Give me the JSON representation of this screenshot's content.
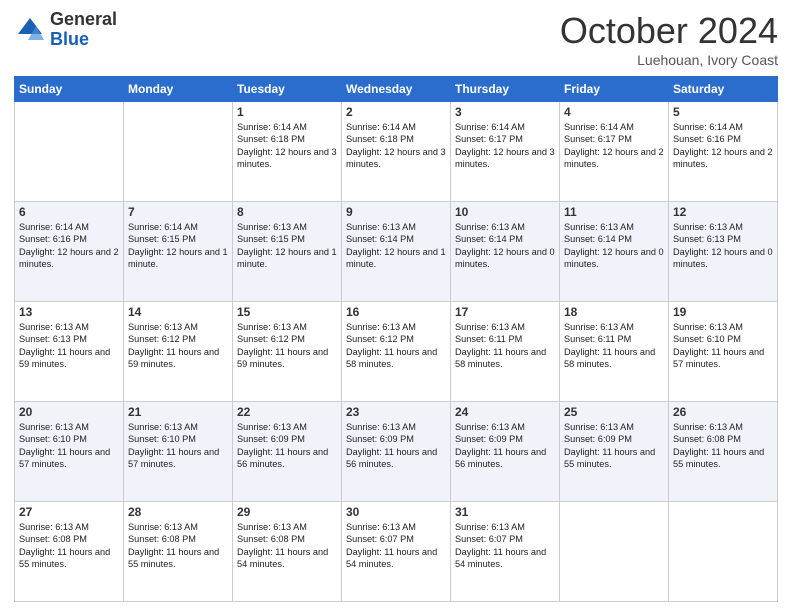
{
  "header": {
    "logo_general": "General",
    "logo_blue": "Blue",
    "month": "October 2024",
    "location": "Luehouan, Ivory Coast"
  },
  "weekdays": [
    "Sunday",
    "Monday",
    "Tuesday",
    "Wednesday",
    "Thursday",
    "Friday",
    "Saturday"
  ],
  "weeks": [
    [
      {
        "day": "",
        "text": ""
      },
      {
        "day": "",
        "text": ""
      },
      {
        "day": "1",
        "text": "Sunrise: 6:14 AM\nSunset: 6:18 PM\nDaylight: 12 hours and 3 minutes."
      },
      {
        "day": "2",
        "text": "Sunrise: 6:14 AM\nSunset: 6:18 PM\nDaylight: 12 hours and 3 minutes."
      },
      {
        "day": "3",
        "text": "Sunrise: 6:14 AM\nSunset: 6:17 PM\nDaylight: 12 hours and 3 minutes."
      },
      {
        "day": "4",
        "text": "Sunrise: 6:14 AM\nSunset: 6:17 PM\nDaylight: 12 hours and 2 minutes."
      },
      {
        "day": "5",
        "text": "Sunrise: 6:14 AM\nSunset: 6:16 PM\nDaylight: 12 hours and 2 minutes."
      }
    ],
    [
      {
        "day": "6",
        "text": "Sunrise: 6:14 AM\nSunset: 6:16 PM\nDaylight: 12 hours and 2 minutes."
      },
      {
        "day": "7",
        "text": "Sunrise: 6:14 AM\nSunset: 6:15 PM\nDaylight: 12 hours and 1 minute."
      },
      {
        "day": "8",
        "text": "Sunrise: 6:13 AM\nSunset: 6:15 PM\nDaylight: 12 hours and 1 minute."
      },
      {
        "day": "9",
        "text": "Sunrise: 6:13 AM\nSunset: 6:14 PM\nDaylight: 12 hours and 1 minute."
      },
      {
        "day": "10",
        "text": "Sunrise: 6:13 AM\nSunset: 6:14 PM\nDaylight: 12 hours and 0 minutes."
      },
      {
        "day": "11",
        "text": "Sunrise: 6:13 AM\nSunset: 6:14 PM\nDaylight: 12 hours and 0 minutes."
      },
      {
        "day": "12",
        "text": "Sunrise: 6:13 AM\nSunset: 6:13 PM\nDaylight: 12 hours and 0 minutes."
      }
    ],
    [
      {
        "day": "13",
        "text": "Sunrise: 6:13 AM\nSunset: 6:13 PM\nDaylight: 11 hours and 59 minutes."
      },
      {
        "day": "14",
        "text": "Sunrise: 6:13 AM\nSunset: 6:12 PM\nDaylight: 11 hours and 59 minutes."
      },
      {
        "day": "15",
        "text": "Sunrise: 6:13 AM\nSunset: 6:12 PM\nDaylight: 11 hours and 59 minutes."
      },
      {
        "day": "16",
        "text": "Sunrise: 6:13 AM\nSunset: 6:12 PM\nDaylight: 11 hours and 58 minutes."
      },
      {
        "day": "17",
        "text": "Sunrise: 6:13 AM\nSunset: 6:11 PM\nDaylight: 11 hours and 58 minutes."
      },
      {
        "day": "18",
        "text": "Sunrise: 6:13 AM\nSunset: 6:11 PM\nDaylight: 11 hours and 58 minutes."
      },
      {
        "day": "19",
        "text": "Sunrise: 6:13 AM\nSunset: 6:10 PM\nDaylight: 11 hours and 57 minutes."
      }
    ],
    [
      {
        "day": "20",
        "text": "Sunrise: 6:13 AM\nSunset: 6:10 PM\nDaylight: 11 hours and 57 minutes."
      },
      {
        "day": "21",
        "text": "Sunrise: 6:13 AM\nSunset: 6:10 PM\nDaylight: 11 hours and 57 minutes."
      },
      {
        "day": "22",
        "text": "Sunrise: 6:13 AM\nSunset: 6:09 PM\nDaylight: 11 hours and 56 minutes."
      },
      {
        "day": "23",
        "text": "Sunrise: 6:13 AM\nSunset: 6:09 PM\nDaylight: 11 hours and 56 minutes."
      },
      {
        "day": "24",
        "text": "Sunrise: 6:13 AM\nSunset: 6:09 PM\nDaylight: 11 hours and 56 minutes."
      },
      {
        "day": "25",
        "text": "Sunrise: 6:13 AM\nSunset: 6:09 PM\nDaylight: 11 hours and 55 minutes."
      },
      {
        "day": "26",
        "text": "Sunrise: 6:13 AM\nSunset: 6:08 PM\nDaylight: 11 hours and 55 minutes."
      }
    ],
    [
      {
        "day": "27",
        "text": "Sunrise: 6:13 AM\nSunset: 6:08 PM\nDaylight: 11 hours and 55 minutes."
      },
      {
        "day": "28",
        "text": "Sunrise: 6:13 AM\nSunset: 6:08 PM\nDaylight: 11 hours and 55 minutes."
      },
      {
        "day": "29",
        "text": "Sunrise: 6:13 AM\nSunset: 6:08 PM\nDaylight: 11 hours and 54 minutes."
      },
      {
        "day": "30",
        "text": "Sunrise: 6:13 AM\nSunset: 6:07 PM\nDaylight: 11 hours and 54 minutes."
      },
      {
        "day": "31",
        "text": "Sunrise: 6:13 AM\nSunset: 6:07 PM\nDaylight: 11 hours and 54 minutes."
      },
      {
        "day": "",
        "text": ""
      },
      {
        "day": "",
        "text": ""
      }
    ]
  ]
}
